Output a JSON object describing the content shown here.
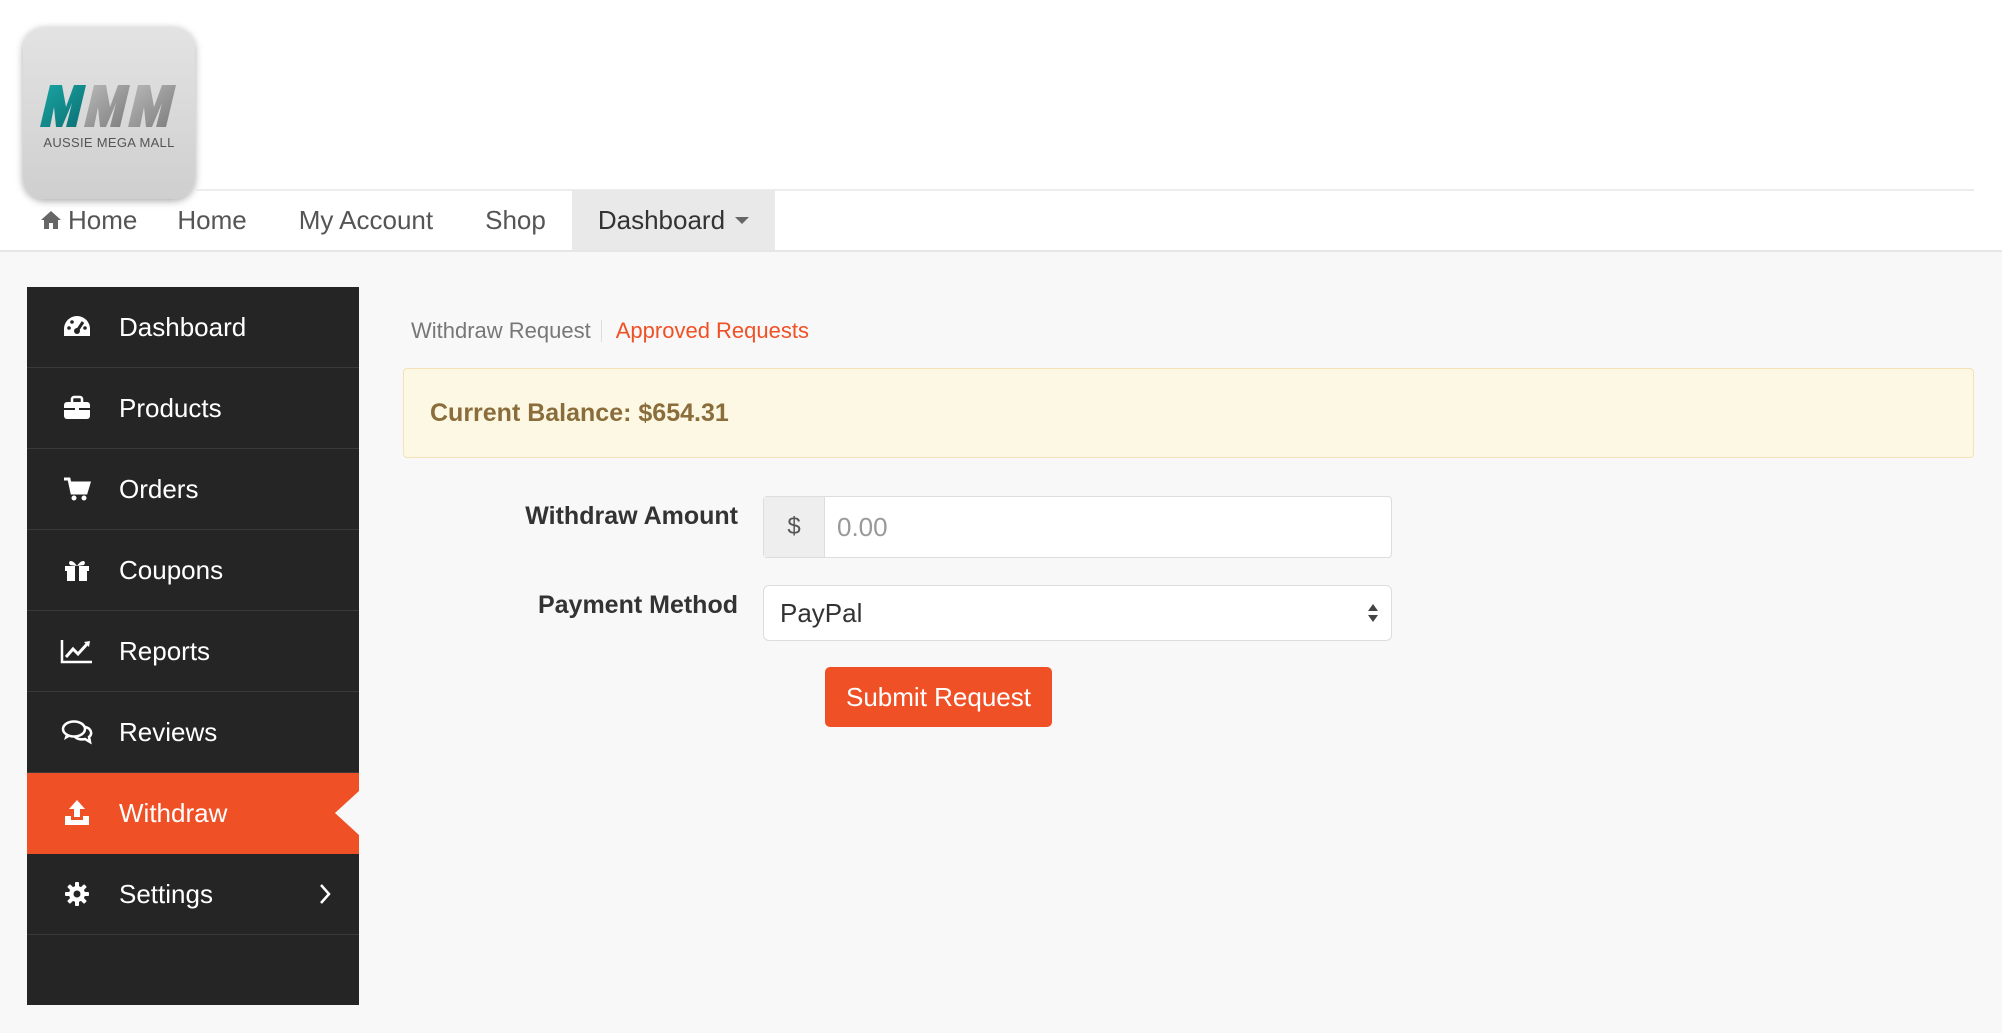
{
  "brand": {
    "logo_text": "AUSSIE MEGA MALL"
  },
  "nav": {
    "home_icon_label": "Home",
    "items": [
      "Home",
      "My Account",
      "Shop",
      "Dashboard"
    ]
  },
  "sidebar": {
    "items": [
      {
        "label": "Dashboard",
        "icon": "dashboard-icon"
      },
      {
        "label": "Products",
        "icon": "briefcase-icon"
      },
      {
        "label": "Orders",
        "icon": "cart-icon"
      },
      {
        "label": "Coupons",
        "icon": "gift-icon"
      },
      {
        "label": "Reports",
        "icon": "line-chart-icon"
      },
      {
        "label": "Reviews",
        "icon": "comments-icon"
      },
      {
        "label": "Withdraw",
        "icon": "upload-icon",
        "active": true
      },
      {
        "label": "Settings",
        "icon": "gear-icon"
      }
    ]
  },
  "withdraw": {
    "tabs": [
      "Withdraw Request",
      "Approved Requests"
    ],
    "balance_text": "Current Balance: $654.31",
    "amount_label": "Withdraw Amount",
    "currency_symbol": "$",
    "amount_placeholder": "0.00",
    "payment_label": "Payment Method",
    "payment_selected": "PayPal",
    "submit_label": "Submit Request"
  },
  "colors": {
    "accent": "#f05025",
    "sidebar_bg": "#252525",
    "alert_bg": "#fcf8e3",
    "alert_text": "#8a6d3b"
  }
}
